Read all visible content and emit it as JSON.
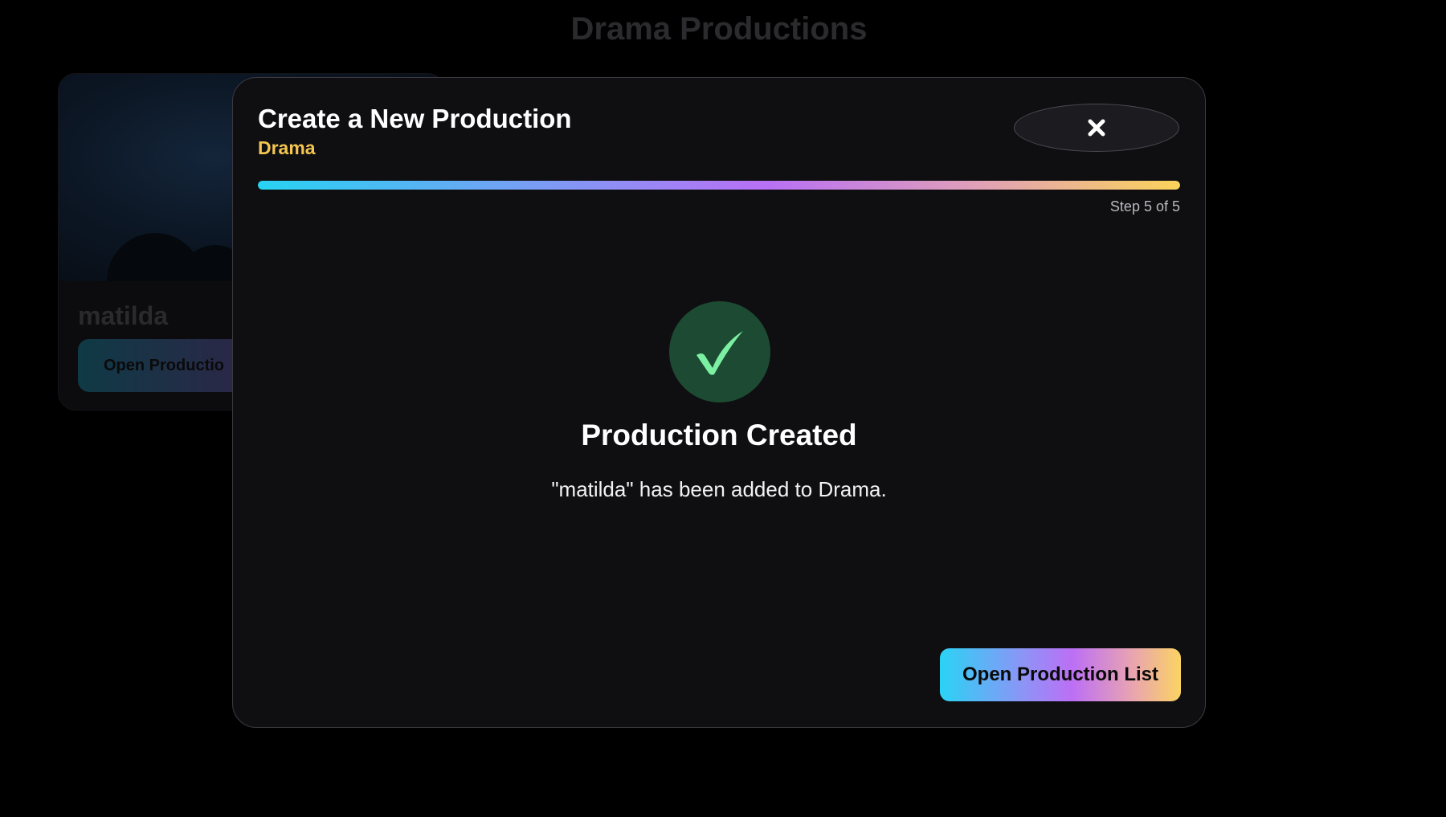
{
  "background": {
    "page_title": "Drama Productions",
    "card": {
      "title": "matilda",
      "button_label": "Open Productio"
    }
  },
  "modal": {
    "title": "Create a New Production",
    "subtitle": "Drama",
    "close_icon": "close-x-icon",
    "progress": {
      "step_label": "Step 5 of 5",
      "current_step": 5,
      "total_steps": 5,
      "fraction": 1.0
    },
    "success": {
      "icon": "checkmark-icon",
      "heading": "Production Created",
      "message": "\"matilda\" has been added to Drama."
    },
    "primary_button_label": "Open Production List"
  },
  "colors": {
    "accent_yellow": "#f4c54f",
    "success_green": "#7cf0a2",
    "success_badge_bg": "#1d4a32",
    "gradient_start": "#27d3f3",
    "gradient_mid": "#b870f5",
    "gradient_end": "#fbd35a"
  }
}
